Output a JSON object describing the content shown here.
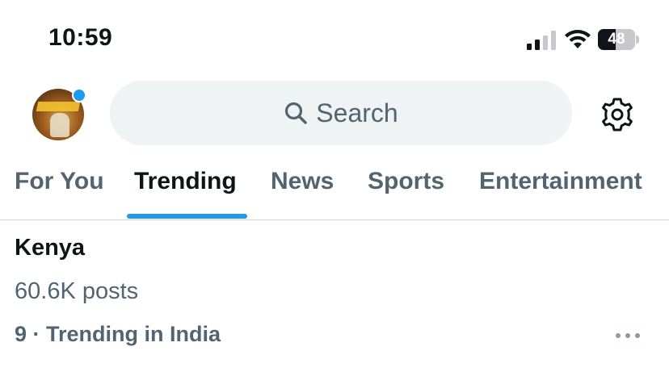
{
  "status_bar": {
    "time": "10:59",
    "battery_level": "48",
    "battery_fraction": 0.48
  },
  "header": {
    "avatar_icon": "profile-avatar",
    "notification_color": "#1d9bf0",
    "search_placeholder": "Search",
    "settings_icon": "gear-icon"
  },
  "tabs": [
    {
      "label": "For You",
      "active": false
    },
    {
      "label": "Trending",
      "active": true
    },
    {
      "label": "News",
      "active": false
    },
    {
      "label": "Sports",
      "active": false
    },
    {
      "label": "Entertainment",
      "active": false
    }
  ],
  "trends": [
    {
      "title": "Kenya",
      "post_count": "60.6K posts",
      "context": "9 · Trending in India"
    }
  ],
  "colors": {
    "accent": "#1d9bf0",
    "primary_text": "#0f1419",
    "secondary_text": "#536471",
    "search_bg": "#eff3f4"
  }
}
